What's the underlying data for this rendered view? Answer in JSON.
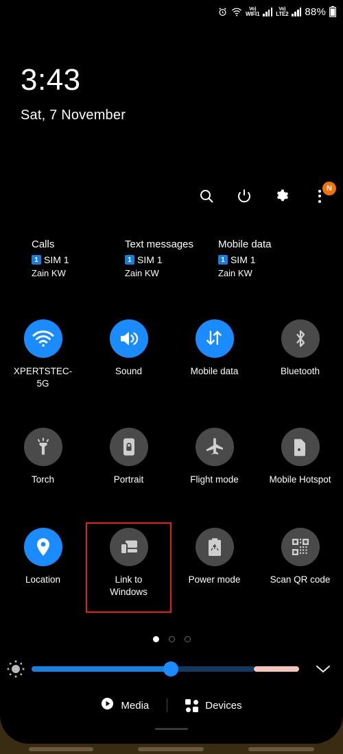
{
  "status_bar": {
    "alarm_icon": "alarm-clock-icon",
    "wifi_icon": "wifi-transfer-icon",
    "sim1": {
      "volte": "Vo)",
      "network": "WIFI1",
      "signal_icon": "signal-bars-icon"
    },
    "sim2": {
      "volte": "Vo)",
      "network": "LTE2",
      "signal_icon": "signal-bars-icon"
    },
    "battery_percent": "88%",
    "battery_icon": "battery-icon"
  },
  "clock": {
    "time": "3:43",
    "date": "Sat, 7 November"
  },
  "header_actions": [
    {
      "name": "search-icon",
      "label": "Search"
    },
    {
      "name": "power-icon",
      "label": "Power"
    },
    {
      "name": "gear-icon",
      "label": "Settings"
    },
    {
      "name": "kebab-menu-icon",
      "label": "More options",
      "badge": "N"
    }
  ],
  "sim_info": [
    {
      "title": "Calls",
      "chip": "1",
      "sim": "SIM 1",
      "carrier": "Zain KW"
    },
    {
      "title": "Text messages",
      "chip": "1",
      "sim": "SIM 1",
      "carrier": "Zain KW"
    },
    {
      "title": "Mobile data",
      "chip": "1",
      "sim": "SIM 1",
      "carrier": "Zain KW"
    }
  ],
  "tiles": {
    "row1": [
      {
        "label": "XPERTSTEC-5G",
        "icon": "wifi-icon",
        "active": true
      },
      {
        "label": "Sound",
        "icon": "volume-icon",
        "active": true
      },
      {
        "label": "Mobile data",
        "icon": "mobile-data-icon",
        "active": true
      },
      {
        "label": "Bluetooth",
        "icon": "bluetooth-icon",
        "active": false
      }
    ],
    "row2": [
      {
        "label": "Torch",
        "icon": "flashlight-icon",
        "active": false
      },
      {
        "label": "Portrait",
        "icon": "rotation-lock-icon",
        "active": false
      },
      {
        "label": "Flight mode",
        "icon": "airplane-icon",
        "active": false
      },
      {
        "label": "Mobile Hotspot",
        "icon": "hotspot-icon",
        "active": false
      }
    ],
    "row3": [
      {
        "label": "Location",
        "icon": "location-pin-icon",
        "active": true
      },
      {
        "label": "Link to Windows",
        "icon": "link-to-windows-icon",
        "active": false,
        "highlighted": true
      },
      {
        "label": "Power mode",
        "icon": "power-mode-icon",
        "active": false
      },
      {
        "label": "Scan QR code",
        "icon": "qr-code-icon",
        "active": false
      }
    ]
  },
  "page_dots": {
    "count": 3,
    "active_index": 0
  },
  "brightness": {
    "auto_icon": "auto-brightness-icon",
    "value_percent": 52,
    "expand_icon": "chevron-down-icon"
  },
  "bottom_bar": {
    "media_label": "Media",
    "media_icon": "play-circle-icon",
    "devices_label": "Devices",
    "devices_icon": "devices-grid-icon"
  },
  "colors": {
    "accent_blue": "#1a8cff",
    "tile_inactive": "#4a4a4a",
    "highlight_red": "#e02020",
    "badge_orange": "#f2720c",
    "sim_chip_blue": "#1a7fd4",
    "slider_pink": "#f5c5bd",
    "bezel_brown": "#3a2c12"
  }
}
